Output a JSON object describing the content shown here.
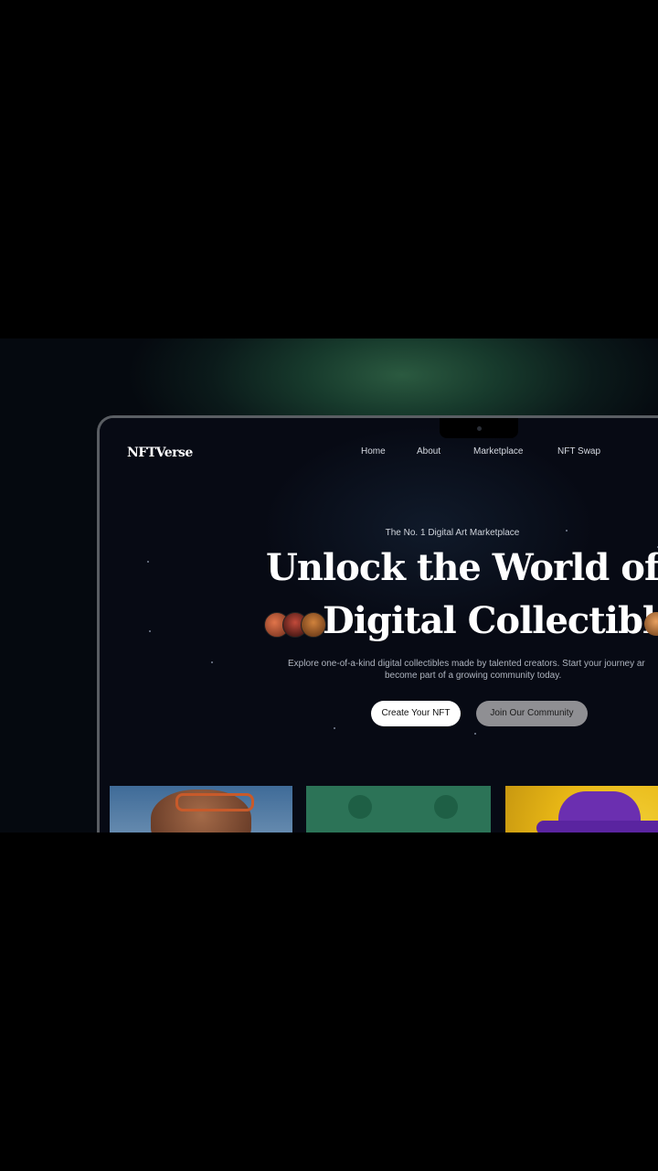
{
  "brand": {
    "logo": "NFTVerse"
  },
  "nav": {
    "items": [
      "Home",
      "About",
      "Marketplace",
      "NFT Swap"
    ]
  },
  "hero": {
    "tagline": "The No. 1 Digital Art Marketplace",
    "headline_line1": "Unlock the World of Rar",
    "headline_line2": "Digital Collectibles",
    "description_line1": "Explore one-of-a-kind digital collectibles made by talented creators. Start your journey ar",
    "description_line2": "become part of a growing community today.",
    "primary_button": "Create Your NFT",
    "secondary_button": "Join Our Community"
  },
  "cards": [
    {
      "subject": "monkey-with-sunglasses",
      "bg": "#4f7aa6"
    },
    {
      "subject": "green-bear",
      "bg": "#2c7357"
    },
    {
      "subject": "purple-hat",
      "bg": "#e9b816"
    }
  ],
  "colors": {
    "accent_glow": "#2b5a40",
    "screen_bg": "#070a14",
    "primary_btn": "#ffffff",
    "secondary_btn": "#8f8f93"
  }
}
